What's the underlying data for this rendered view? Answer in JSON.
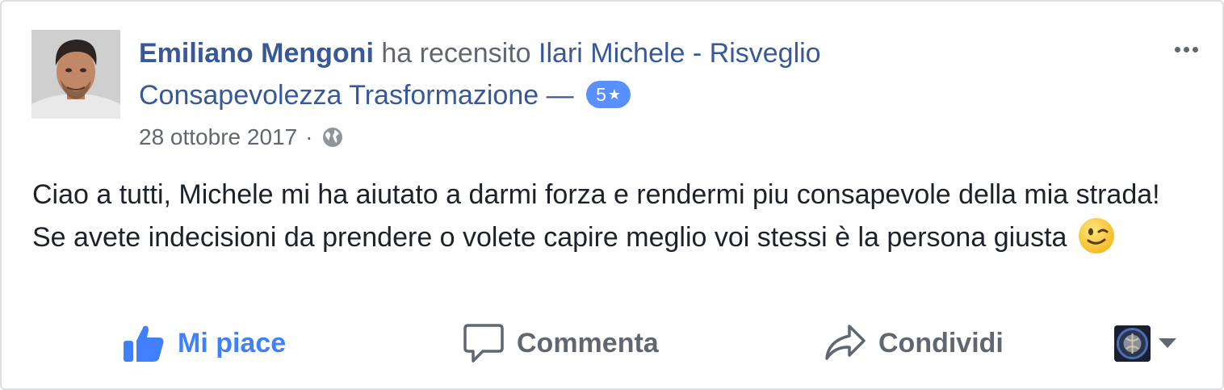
{
  "review": {
    "author_name": "Emiliano Mengoni",
    "action_text": "ha recensito",
    "page_name": "Ilari Michele - Risveglio Consapevolezza Trasformazione",
    "dash": "—",
    "rating": "5",
    "rating_icon": "star-icon",
    "date": "28 ottobre 2017",
    "separator": "·",
    "privacy_icon": "globe-icon",
    "text": "Ciao a tutti, Michele mi ha aiutato a darmi forza e rendermi piu consapevole della mia strada! Se avete indecisioni da prendere o volete capire meglio voi stessi è la persona giusta",
    "emoji": "winking-face-emoji"
  },
  "actions": {
    "like_label": "Mi piace",
    "comment_label": "Commenta",
    "share_label": "Condividi"
  },
  "colors": {
    "link": "#385898",
    "like_blue": "#4080ff",
    "badge": "#5890ff",
    "muted": "#616770",
    "text": "#1d2129",
    "border": "#dddfe2"
  }
}
